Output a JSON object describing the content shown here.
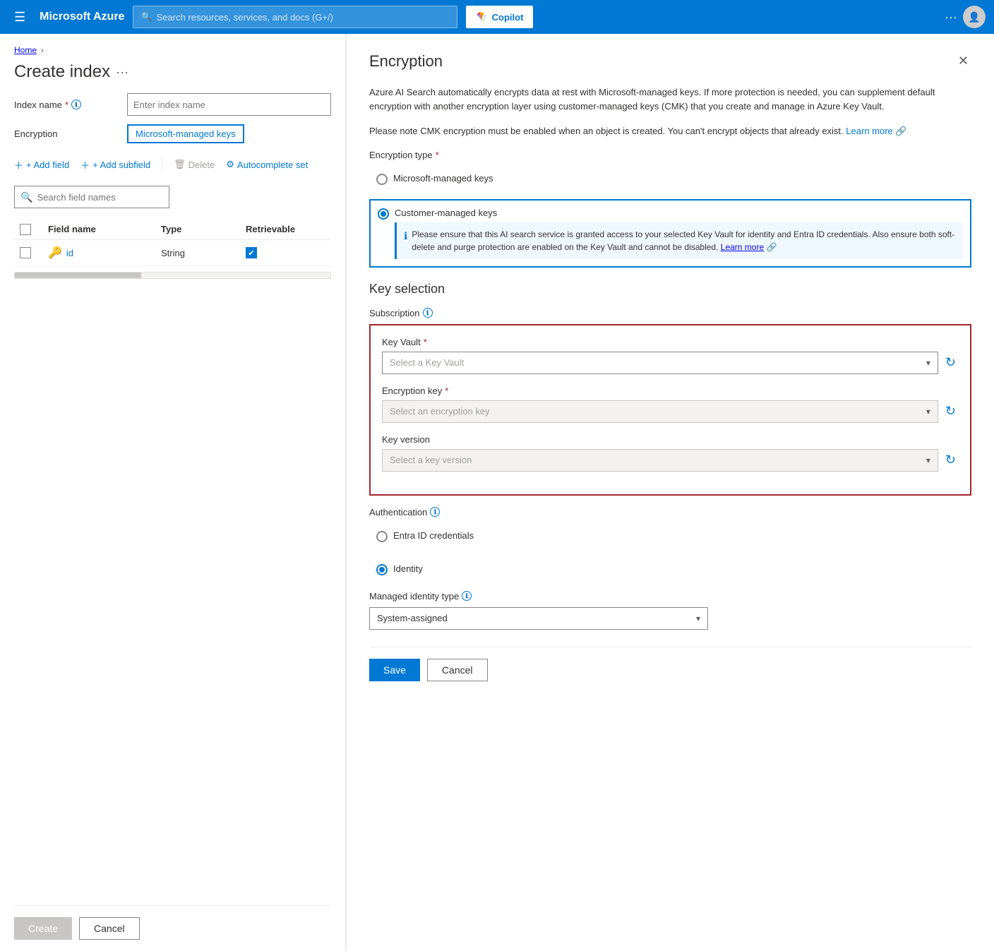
{
  "topnav": {
    "hamburger": "☰",
    "logo": "Microsoft Azure",
    "search_placeholder": "Search resources, services, and docs (G+/)",
    "copilot_label": "Copilot",
    "dots": "···",
    "avatar": "👤"
  },
  "breadcrumb": {
    "home": "Home",
    "sep": "›"
  },
  "left_panel": {
    "page_title": "Create index",
    "page_title_dots": "···",
    "index_name_label": "Index name",
    "index_name_required": "*",
    "index_name_info": "ℹ",
    "index_name_placeholder": "Enter index name",
    "encryption_label": "Encryption",
    "encryption_link": "Microsoft-managed keys",
    "add_field_btn": "+ Add field",
    "add_subfield_btn": "+ Add subfield",
    "delete_btn": "Delete",
    "delete_icon": "🗑",
    "autocomplete_btn": "Autocomplete set",
    "autocomplete_icon": "⚙",
    "search_placeholder": "Search field names",
    "table": {
      "col_field_name": "Field name",
      "col_type": "Type",
      "col_retrievable": "Retrievable",
      "rows": [
        {
          "icon": "🔑",
          "field_name": "id",
          "type": "String",
          "retrievable": "✔"
        }
      ]
    },
    "create_btn": "Create",
    "cancel_btn": "Cancel"
  },
  "right_panel": {
    "title": "Encryption",
    "close_icon": "✕",
    "description1": "Azure AI Search automatically encrypts data at rest with Microsoft-managed keys. If more protection is needed, you can supplement default encryption with another encryption layer using customer-managed keys (CMK) that you create and manage in Azure Key Vault.",
    "description2": "Please note CMK encryption must be enabled when an object is created. You can't encrypt objects that already exist.",
    "learn_more": "Learn more",
    "learn_more2": "Learn more",
    "encryption_type_label": "Encryption type",
    "encryption_type_required": "*",
    "option_microsoft": "Microsoft-managed keys",
    "option_customer": "Customer-managed keys",
    "customer_info": "Please ensure that this AI search service is granted access to your selected Key Vault for identity and Entra ID credentials. Also ensure both soft-delete and purge protection are enabled on the Key Vault and cannot be disabled.",
    "key_selection_title": "Key selection",
    "subscription_label": "Subscription",
    "subscription_info": "ℹ",
    "key_vault_label": "Key Vault",
    "key_vault_required": "*",
    "key_vault_placeholder": "Select a Key Vault",
    "encryption_key_label": "Encryption key",
    "encryption_key_required": "*",
    "encryption_key_placeholder": "Select an encryption key",
    "key_version_label": "Key version",
    "key_version_placeholder": "Select a key version",
    "authentication_label": "Authentication",
    "authentication_info": "ℹ",
    "option_entra": "Entra ID credentials",
    "option_identity": "Identity",
    "managed_identity_label": "Managed identity type",
    "managed_identity_info": "ℹ",
    "managed_identity_value": "System-assigned",
    "save_btn": "Save",
    "cancel_btn": "Cancel"
  }
}
